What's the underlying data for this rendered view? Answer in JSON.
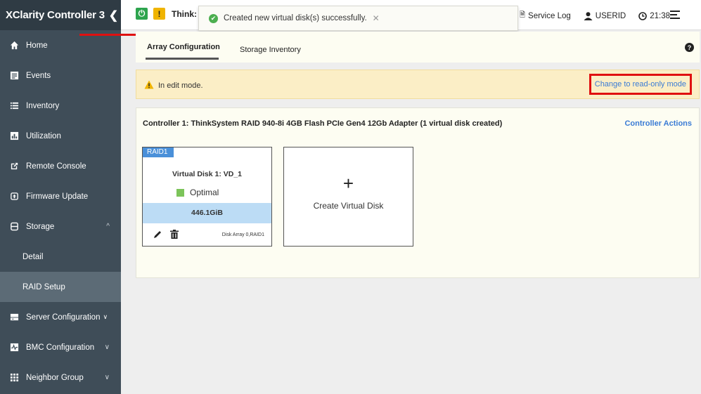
{
  "sidebar": {
    "brand": "XClarity Controller 3",
    "items": [
      {
        "label": "Home"
      },
      {
        "label": "Events"
      },
      {
        "label": "Inventory"
      },
      {
        "label": "Utilization"
      },
      {
        "label": "Remote Console"
      },
      {
        "label": "Firmware Update"
      },
      {
        "label": "Storage"
      },
      {
        "label": "Detail"
      },
      {
        "label": "RAID Setup"
      },
      {
        "label": "Server Configuration"
      },
      {
        "label": "BMC Configuration"
      },
      {
        "label": "Neighbor Group"
      }
    ]
  },
  "topbar": {
    "system_name": "Think:",
    "toast_message": "Created new virtual disk(s) successfully.",
    "service_log": "Service Log",
    "user": "USERID",
    "time": "21:38"
  },
  "tabs": [
    {
      "label": "Array Configuration",
      "active": true
    },
    {
      "label": "Storage Inventory",
      "active": false
    }
  ],
  "edit_banner": {
    "message": "In edit mode.",
    "link": "Change to read-only mode"
  },
  "controller": {
    "title": "Controller 1: ThinkSystem RAID 940-8i 4GB Flash PCIe Gen4 12Gb Adapter (1 virtual disk created)",
    "actions": "Controller Actions",
    "virtual_disk": {
      "raid_level": "RAID1",
      "name": "Virtual Disk 1: VD_1",
      "status": "Optimal",
      "size": "446.1GiB",
      "array": "Disk Array 0,RAID1"
    },
    "create_label": "Create Virtual Disk"
  },
  "colors": {
    "sidebar_bg": "#3f4d58",
    "accent_link": "#3a7bd5",
    "status_ok": "#7cc45a",
    "raid_tag": "#4a90d9",
    "highlight_box": "#e01010"
  }
}
